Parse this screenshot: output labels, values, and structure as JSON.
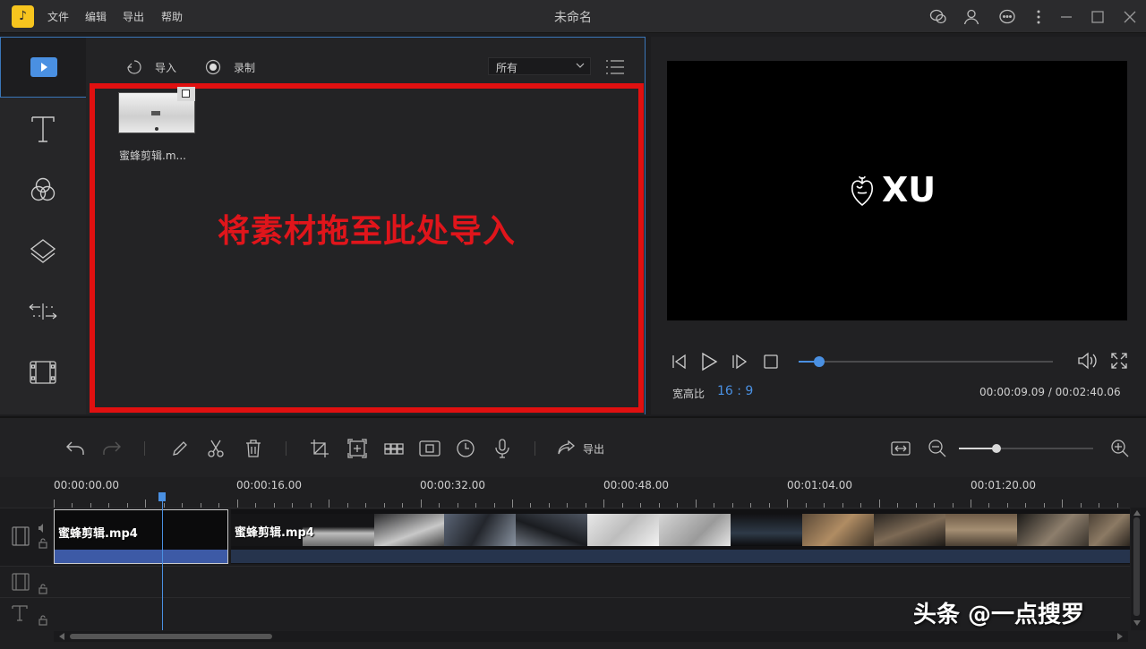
{
  "titlebar": {
    "logo_glyph": "♪",
    "menu": [
      "文件",
      "编辑",
      "导出",
      "帮助"
    ],
    "title": "未命名",
    "icons": [
      "feedback-icon",
      "user-icon",
      "chat-icon",
      "more-icon",
      "minimize-icon",
      "maximize-icon",
      "close-icon"
    ]
  },
  "sidebar": {
    "items": [
      "media-icon",
      "text-icon",
      "filter-icon",
      "overlay-icon",
      "transition-icon",
      "element-icon"
    ]
  },
  "media": {
    "import_label": "导入",
    "record_label": "录制",
    "filter_value": "所有",
    "drop_hint": "将素材拖至此处导入",
    "files": [
      {
        "name": "蜜蜂剪辑.m..."
      }
    ]
  },
  "preview": {
    "logo_text": "XU",
    "ratio_label": "宽高比",
    "ratio_value": "16 : 9",
    "time_display": "00:00:09.09 / 00:02:40.06",
    "progress": 0.08
  },
  "timeline": {
    "export_label": "导出",
    "ruler": [
      "00:00:00.00",
      "00:00:16.00",
      "00:00:32.00",
      "00:00:48.00",
      "00:01:04.00",
      "00:01:20.00"
    ],
    "clips": [
      {
        "name": "蜜蜂剪辑.mp4"
      },
      {
        "name": "蜜蜂剪辑.mp4"
      }
    ],
    "zoom_level": 0.28
  },
  "watermark": "头条 @一点搜罗",
  "colors": {
    "accent": "#4a90e2",
    "drop_border": "#e01010",
    "logo_bg": "#f7c51e"
  }
}
